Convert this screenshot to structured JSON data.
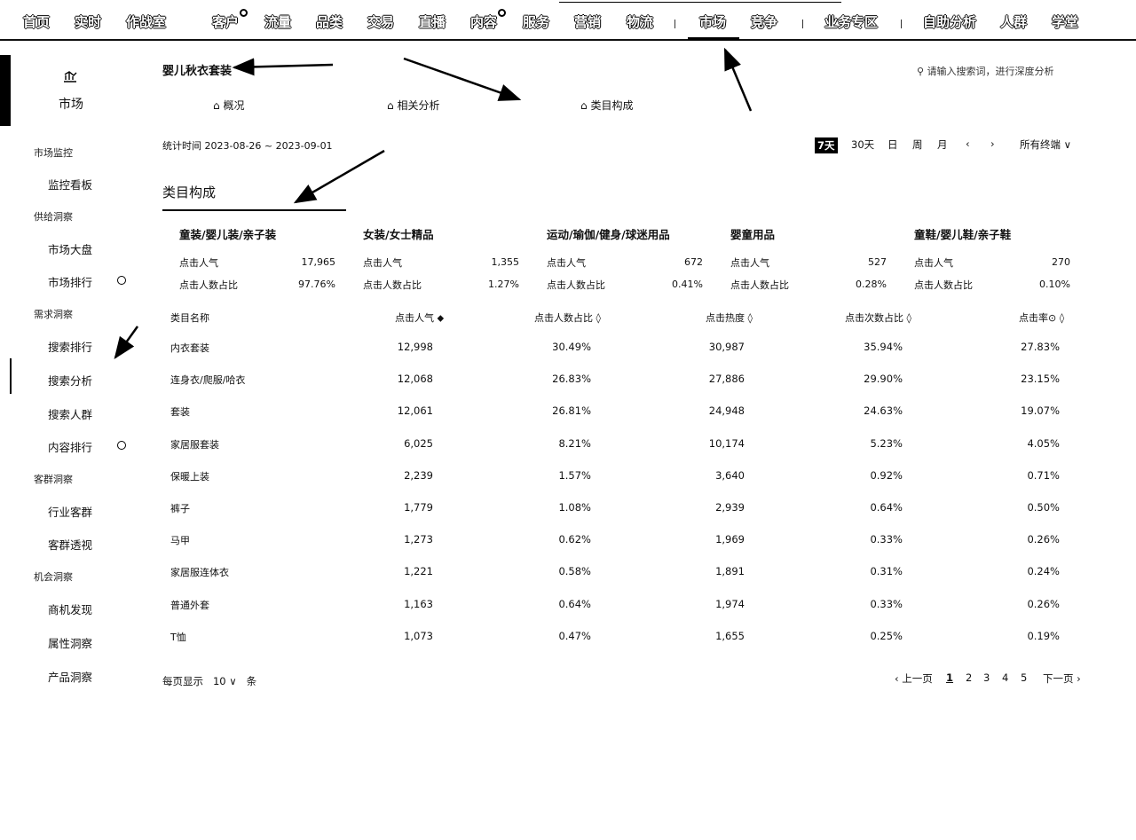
{
  "topnav": {
    "items": [
      "首页",
      "实时",
      "作战室",
      "客户",
      "流量",
      "品类",
      "交易",
      "直播",
      "内容",
      "服务",
      "营销",
      "物流",
      "市场",
      "竞争",
      "业务专区",
      "自助分析",
      "人群",
      "学堂"
    ],
    "active": "市场"
  },
  "sidebar": {
    "header": "市场",
    "groups": [
      {
        "label": "市场监控",
        "items": [
          "监控看板"
        ]
      },
      {
        "label": "供给洞察",
        "items": [
          "市场大盘",
          "市场排行"
        ]
      },
      {
        "label": "需求洞察",
        "items": [
          "搜索排行",
          "搜索分析",
          "搜索人群",
          "内容排行"
        ]
      },
      {
        "label": "客群洞察",
        "items": [
          "行业客群",
          "客群透视"
        ]
      },
      {
        "label": "机会洞察",
        "items": [
          "商机发现",
          "属性洞察",
          "产品洞察"
        ]
      }
    ]
  },
  "main": {
    "title": "婴儿秋衣套装",
    "search_placeholder": "请输入搜索词，进行深度分析",
    "subtabs": [
      "概况",
      "相关分析",
      "类目构成"
    ],
    "period": "统计时间 2023-08-26 ~ 2023-09-01",
    "ranges": [
      "7天",
      "30天",
      "日",
      "周",
      "月",
      "‹",
      "›",
      "所有终端"
    ],
    "active_range": "7天",
    "section_title": "类目构成"
  },
  "cards": [
    {
      "name": "童装/婴儿装/亲子装",
      "clicks_label": "点击人气",
      "clicks": "17,965",
      "ratio_label": "点击人数占比",
      "ratio": "97.76%"
    },
    {
      "name": "女装/女士精品",
      "clicks_label": "点击人气",
      "clicks": "1,355",
      "ratio_label": "点击人数占比",
      "ratio": "1.27%"
    },
    {
      "name": "运动/瑜伽/健身/球迷用品",
      "clicks_label": "点击人气",
      "clicks": "672",
      "ratio_label": "点击人数占比",
      "ratio": "0.41%"
    },
    {
      "name": "婴童用品",
      "clicks_label": "点击人气",
      "clicks": "527",
      "ratio_label": "点击人数占比",
      "ratio": "0.28%"
    },
    {
      "name": "童鞋/婴儿鞋/亲子鞋",
      "clicks_label": "点击人气",
      "clicks": "270",
      "ratio_label": "点击人数占比",
      "ratio": "0.10%"
    }
  ],
  "table": {
    "headers": [
      "类目名称",
      "点击人气 ⬥",
      "点击人数占比 ◊",
      "点击热度 ◊",
      "点击次数占比 ◊",
      "点击率⊙ ◊"
    ],
    "rows": [
      [
        "内衣套装",
        "12,998",
        "30.49%",
        "30,987",
        "35.94%",
        "27.83%"
      ],
      [
        "连身衣/爬服/哈衣",
        "12,068",
        "26.83%",
        "27,886",
        "29.90%",
        "23.15%"
      ],
      [
        "套装",
        "12,061",
        "26.81%",
        "24,948",
        "24.63%",
        "19.07%"
      ],
      [
        "家居服套装",
        "6,025",
        "8.21%",
        "10,174",
        "5.23%",
        "4.05%"
      ],
      [
        "保暖上装",
        "2,239",
        "1.57%",
        "3,640",
        "0.92%",
        "0.71%"
      ],
      [
        "裤子",
        "1,779",
        "1.08%",
        "2,939",
        "0.64%",
        "0.50%"
      ],
      [
        "马甲",
        "1,273",
        "0.62%",
        "1,969",
        "0.33%",
        "0.26%"
      ],
      [
        "家居服连体衣",
        "1,221",
        "0.58%",
        "1,891",
        "0.31%",
        "0.24%"
      ],
      [
        "普通外套",
        "1,163",
        "0.64%",
        "1,974",
        "0.33%",
        "0.26%"
      ],
      [
        "T恤",
        "1,073",
        "0.47%",
        "1,655",
        "0.25%",
        "0.19%"
      ]
    ]
  },
  "pagination": {
    "page_size_label": "每页显示",
    "page_size": "10 ∨",
    "page_size_unit": "条",
    "prev": "‹ 上一页",
    "pages": [
      "1",
      "2",
      "3",
      "4",
      "5"
    ],
    "current": "1",
    "next": "下一页 ›"
  }
}
